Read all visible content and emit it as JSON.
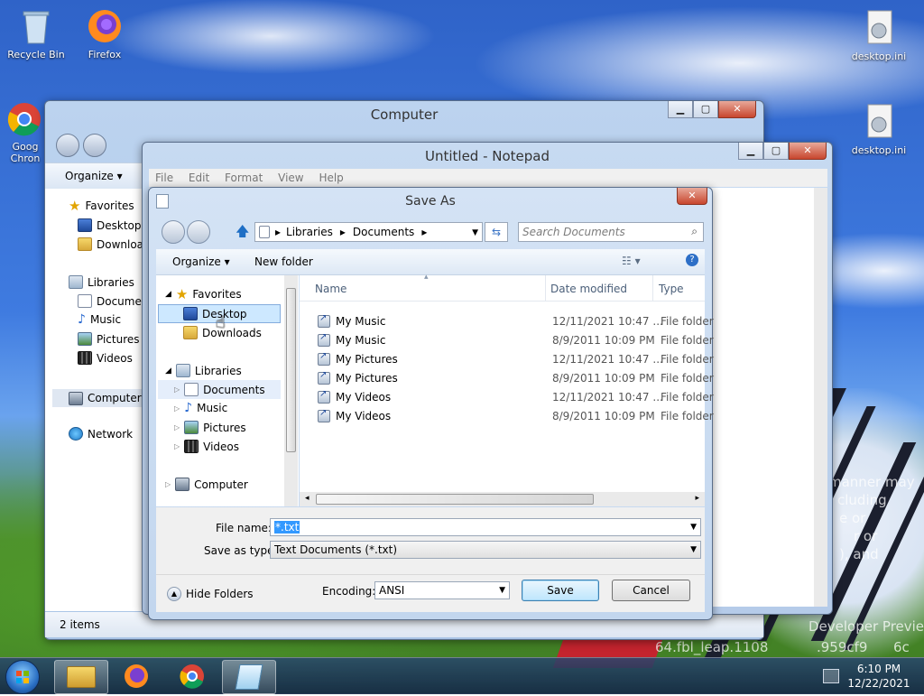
{
  "desktop": {
    "icons": [
      {
        "label": "Recycle Bin"
      },
      {
        "label": "Firefox"
      },
      {
        "label": "Goog Chron"
      },
      {
        "label": "desktop.ini"
      },
      {
        "label": "desktop.ini"
      }
    ],
    "background_text": [
      "manner may",
      "cluding",
      "e or",
      "r or",
      "), and",
      "Developer Previe",
      "64.fbl_leap.1108",
      ".959cf9",
      "6c"
    ]
  },
  "explorer": {
    "title": "Computer",
    "toolbar": {
      "organize": "Organize ▾"
    },
    "nav": {
      "favorites": "Favorites",
      "desktop": "Desktop",
      "downloads": "Download",
      "libraries": "Libraries",
      "documents": "Documer",
      "music": "Music",
      "pictures": "Pictures",
      "videos": "Videos",
      "computer": "Computer",
      "network": "Network"
    },
    "status": "2 items"
  },
  "notepad": {
    "title": "Untitled - Notepad",
    "menu": [
      "File",
      "Edit",
      "Format",
      "View",
      "Help"
    ]
  },
  "saveas": {
    "title": "Save As",
    "breadcrumb": [
      "Libraries",
      "Documents"
    ],
    "search_placeholder": "Search Documents",
    "toolbar": {
      "organize": "Organize",
      "new_folder": "New folder"
    },
    "nav": {
      "favorites": "Favorites",
      "desktop": "Desktop",
      "downloads": "Downloads",
      "libraries": "Libraries",
      "documents": "Documents",
      "music": "Music",
      "pictures": "Pictures",
      "videos": "Videos",
      "computer": "Computer"
    },
    "columns": [
      "Name",
      "Date modified",
      "Type"
    ],
    "files": [
      {
        "name": "My Music",
        "date": "12/11/2021 10:47 ...",
        "type": "File folder"
      },
      {
        "name": "My Music",
        "date": "8/9/2011 10:09 PM",
        "type": "File folder"
      },
      {
        "name": "My Pictures",
        "date": "12/11/2021 10:47 ...",
        "type": "File folder"
      },
      {
        "name": "My Pictures",
        "date": "8/9/2011 10:09 PM",
        "type": "File folder"
      },
      {
        "name": "My Videos",
        "date": "12/11/2021 10:47 ...",
        "type": "File folder"
      },
      {
        "name": "My Videos",
        "date": "8/9/2011 10:09 PM",
        "type": "File folder"
      }
    ],
    "file_name_label": "File name:",
    "file_name_value": "*.txt",
    "save_type_label": "Save as type:",
    "save_type_value": "Text Documents (*.txt)",
    "hide_folders": "Hide Folders",
    "encoding_label": "Encoding:",
    "encoding_value": "ANSI",
    "save_button": "Save",
    "cancel_button": "Cancel"
  },
  "taskbar": {
    "time": "6:10 PM",
    "date": "12/22/2021"
  }
}
